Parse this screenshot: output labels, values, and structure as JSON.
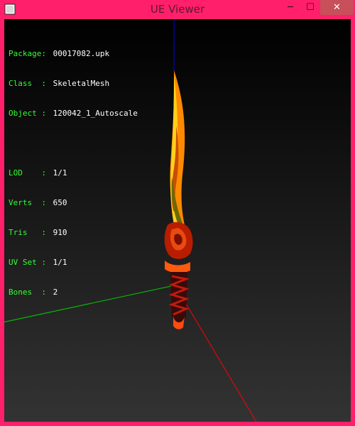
{
  "window": {
    "title": "UE Viewer",
    "minimize_glyph": "─",
    "maximize_glyph": "☐",
    "close_glyph": "✕"
  },
  "info": {
    "package": {
      "label": "Package:",
      "value": "00017082.upk"
    },
    "class": {
      "label": "Class  :",
      "value": "SkeletalMesh"
    },
    "object": {
      "label": "Object :",
      "value": "120042_1_Autoscale"
    },
    "lod": {
      "label": "LOD    :",
      "value": "1/1"
    },
    "verts": {
      "label": "Verts  :",
      "value": "650"
    },
    "tris": {
      "label": "Tris   :",
      "value": "910"
    },
    "uvset": {
      "label": "UV Set :",
      "value": "1/1"
    },
    "bones": {
      "label": "Bones  :",
      "value": "2"
    }
  },
  "colors": {
    "frame": "#ff1f6b",
    "label_text": "#33ff33",
    "value_text": "#ffffff",
    "axis_x": "#ff0000",
    "axis_y": "#00cc00",
    "axis_z": "#0000ff"
  },
  "icons": {
    "app": "ue-viewer-app-icon",
    "minimize": "minimize-icon",
    "maximize": "maximize-icon",
    "close": "close-icon"
  }
}
